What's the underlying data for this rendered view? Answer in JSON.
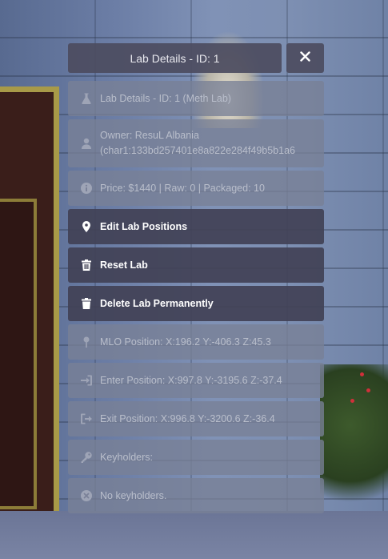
{
  "header": {
    "title": "Lab Details - ID: 1",
    "close_symbol": "✕"
  },
  "colors": {
    "panel_dark": "#424256",
    "panel_light": "#787f96",
    "text_dim": "#b9becb",
    "text_bright": "#ffffff"
  },
  "items": [
    {
      "icon": "flask-icon",
      "label": "Lab Details - ID: 1 (Meth Lab)"
    },
    {
      "icon": "user-icon",
      "line1": "Owner: ResuL Albania",
      "line2": "(char1:133bd257401e8a822e284f49b5b1a6"
    },
    {
      "icon": "info-icon",
      "label": "Price: $1440 | Raw: 0 | Packaged: 10"
    },
    {
      "icon": "map-pin-icon",
      "label": "Edit Lab Positions"
    },
    {
      "icon": "trash-icon",
      "label": "Reset Lab"
    },
    {
      "icon": "trash-icon",
      "label": "Delete Lab Permanently"
    },
    {
      "icon": "map-pin-outline-icon",
      "label": "MLO Position: X:196.2 Y:-406.3 Z:45.3"
    },
    {
      "icon": "sign-in-icon",
      "label": "Enter Position: X:997.8 Y:-3195.6 Z:-37.4"
    },
    {
      "icon": "sign-out-icon",
      "label": "Exit Position: X:996.8 Y:-3200.6 Z:-36.4"
    },
    {
      "icon": "key-icon",
      "label": "Keyholders:"
    },
    {
      "icon": "circle-x-icon",
      "label": "No keyholders."
    }
  ]
}
